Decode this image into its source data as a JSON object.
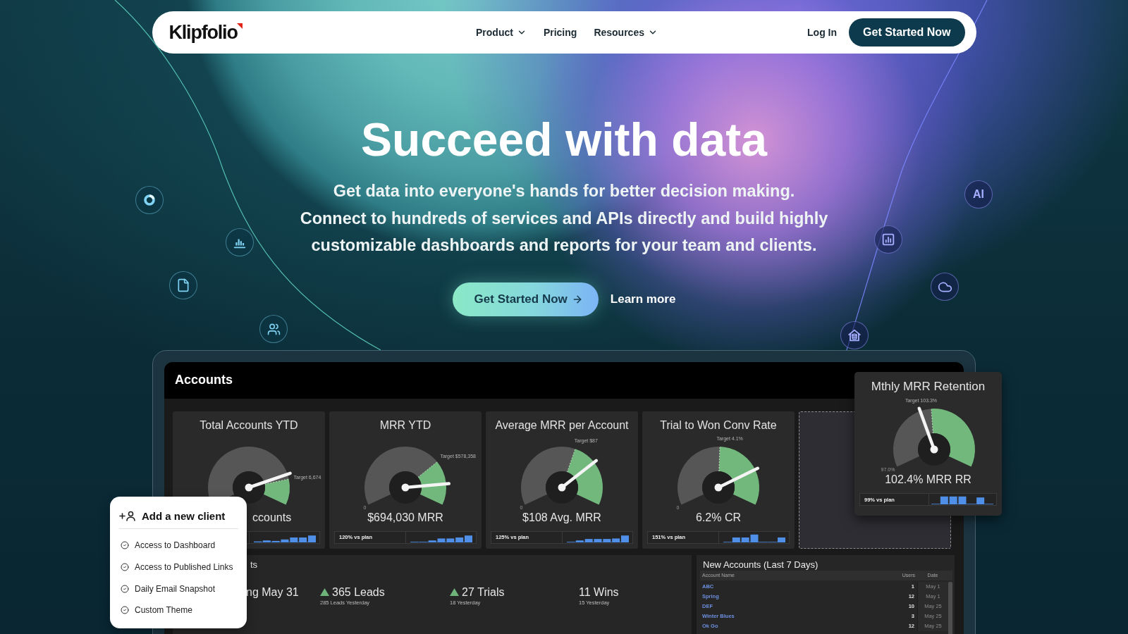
{
  "nav": {
    "logo": "Klipfolio",
    "links": [
      {
        "label": "Product",
        "dropdown": true
      },
      {
        "label": "Pricing",
        "dropdown": false
      },
      {
        "label": "Resources",
        "dropdown": true
      }
    ],
    "login": "Log In",
    "cta": "Get Started Now"
  },
  "hero": {
    "title": "Succeed with data",
    "subtitle": [
      "Get data into everyone's hands for better decision making.",
      "Connect to hundreds of services and APIs directly and build highly customizable dashboards and reports for your team and clients."
    ],
    "primary_button": "Get Started Now",
    "secondary_link": "Learn more",
    "badge": "AI"
  },
  "dashboard": {
    "title": "Accounts",
    "cards": [
      {
        "title": "Total Accounts YTD",
        "target_label": "Target 6,674",
        "value": "ccounts"
      },
      {
        "title": "MRR YTD",
        "target_label": "Target $578,358",
        "min_label": "0",
        "value": "$694,030 MRR",
        "vs_plan": "120% vs plan"
      },
      {
        "title": "Average MRR per Account",
        "target_label": "Target $87",
        "min_label": "0",
        "value": "$108 Avg. MRR",
        "vs_plan": "125% vs plan"
      },
      {
        "title": "Trial to Won Conv Rate",
        "target_label": "Target 4.1%",
        "min_label": "0",
        "value": "6.2% CR",
        "vs_plan": "151% vs plan"
      }
    ],
    "retention_card": {
      "title": "Mthly MRR Retention",
      "target_label": "Target 103.3%",
      "min_label": "97.0%",
      "value": "102.4% MRR RR",
      "vs_plan": "99% vs plan"
    },
    "highlights": {
      "title": "ts",
      "stats": [
        {
          "value": "ng May 31",
          "rising": false
        },
        {
          "value": "365 Leads",
          "note": "285 Leads Yesterday",
          "rising": true
        },
        {
          "value": "27 Trials",
          "note": "18 Yesterday",
          "rising": true
        },
        {
          "value": "11 Wins",
          "note": "15 Yesterday",
          "rising": false
        }
      ]
    },
    "new_accounts": {
      "title": "New Accounts (Last 7 Days)",
      "columns": [
        "Account Name",
        "Users",
        "Date"
      ],
      "rows": [
        {
          "name": "ABC",
          "users": "1",
          "date": "May 1"
        },
        {
          "name": "Spring",
          "users": "12",
          "date": "May 1"
        },
        {
          "name": "DEF",
          "users": "10",
          "date": "May 25"
        },
        {
          "name": "Winter Blues",
          "users": "3",
          "date": "May 25"
        },
        {
          "name": "Ok Go",
          "users": "12",
          "date": "May 25"
        }
      ]
    }
  },
  "client_popup": {
    "title": "Add a new client",
    "items": [
      "Access to Dashboard",
      "Access to Published Links",
      "Daily Email Snapshot",
      "Custom Theme"
    ]
  }
}
